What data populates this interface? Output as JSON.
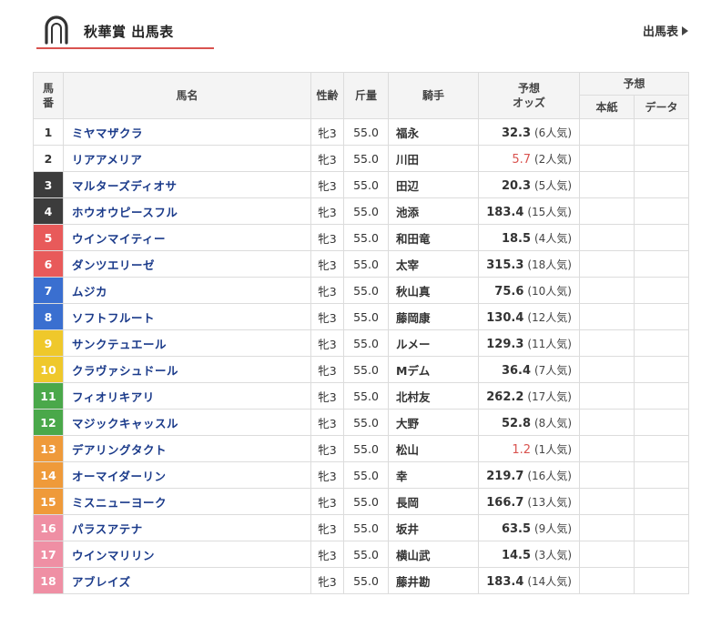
{
  "header": {
    "title": "秋華賞 出馬表",
    "link_label": "出馬表"
  },
  "colors": {
    "accent": "#d9534f",
    "horse_name": "#1a3a8a"
  },
  "table": {
    "col_num": "馬番",
    "col_name": "馬名",
    "col_sex_age": "性齢",
    "col_weight": "斤量",
    "col_jockey": "騎手",
    "col_odds_l1": "予想",
    "col_odds_l2": "オッズ",
    "col_prediction": "予想",
    "col_pred_paper": "本紙",
    "col_pred_data": "データ"
  },
  "rows": [
    {
      "num": "1",
      "name": "ミヤマザクラ",
      "sex_age": "牝3",
      "weight": "55.0",
      "jockey": "福永",
      "odds": "32.3",
      "pop": "(6人気)",
      "bg": "#ffffff",
      "fg": "#333333"
    },
    {
      "num": "2",
      "name": "リアアメリア",
      "sex_age": "牝3",
      "weight": "55.0",
      "jockey": "川田",
      "odds": "5.7",
      "pop": "(2人気)",
      "bg": "#ffffff",
      "fg": "#333333"
    },
    {
      "num": "3",
      "name": "マルターズディオサ",
      "sex_age": "牝3",
      "weight": "55.0",
      "jockey": "田辺",
      "odds": "20.3",
      "pop": "(5人気)",
      "bg": "#3c3c3c",
      "fg": "#ffffff"
    },
    {
      "num": "4",
      "name": "ホウオウピースフル",
      "sex_age": "牝3",
      "weight": "55.0",
      "jockey": "池添",
      "odds": "183.4",
      "pop": "(15人気)",
      "bg": "#3c3c3c",
      "fg": "#ffffff"
    },
    {
      "num": "5",
      "name": "ウインマイティー",
      "sex_age": "牝3",
      "weight": "55.0",
      "jockey": "和田竜",
      "odds": "18.5",
      "pop": "(4人気)",
      "bg": "#e85a5a",
      "fg": "#ffffff"
    },
    {
      "num": "6",
      "name": "ダンツエリーゼ",
      "sex_age": "牝3",
      "weight": "55.0",
      "jockey": "太宰",
      "odds": "315.3",
      "pop": "(18人気)",
      "bg": "#e85a5a",
      "fg": "#ffffff"
    },
    {
      "num": "7",
      "name": "ムジカ",
      "sex_age": "牝3",
      "weight": "55.0",
      "jockey": "秋山真",
      "odds": "75.6",
      "pop": "(10人気)",
      "bg": "#3a6fd0",
      "fg": "#ffffff"
    },
    {
      "num": "8",
      "name": "ソフトフルート",
      "sex_age": "牝3",
      "weight": "55.0",
      "jockey": "藤岡康",
      "odds": "130.4",
      "pop": "(12人気)",
      "bg": "#3a6fd0",
      "fg": "#ffffff"
    },
    {
      "num": "9",
      "name": "サンクテュエール",
      "sex_age": "牝3",
      "weight": "55.0",
      "jockey": "ルメー",
      "odds": "129.3",
      "pop": "(11人気)",
      "bg": "#efc82b",
      "fg": "#ffffff"
    },
    {
      "num": "10",
      "name": "クラヴァシュドール",
      "sex_age": "牝3",
      "weight": "55.0",
      "jockey": "Mデム",
      "odds": "36.4",
      "pop": "(7人気)",
      "bg": "#efc82b",
      "fg": "#ffffff"
    },
    {
      "num": "11",
      "name": "フィオリキアリ",
      "sex_age": "牝3",
      "weight": "55.0",
      "jockey": "北村友",
      "odds": "262.2",
      "pop": "(17人気)",
      "bg": "#4aa84a",
      "fg": "#ffffff"
    },
    {
      "num": "12",
      "name": "マジックキャッスル",
      "sex_age": "牝3",
      "weight": "55.0",
      "jockey": "大野",
      "odds": "52.8",
      "pop": "(8人気)",
      "bg": "#4aa84a",
      "fg": "#ffffff"
    },
    {
      "num": "13",
      "name": "デアリングタクト",
      "sex_age": "牝3",
      "weight": "55.0",
      "jockey": "松山",
      "odds": "1.2",
      "pop": "(1人気)",
      "bg": "#ef9a3a",
      "fg": "#ffffff"
    },
    {
      "num": "14",
      "name": "オーマイダーリン",
      "sex_age": "牝3",
      "weight": "55.0",
      "jockey": "幸",
      "odds": "219.7",
      "pop": "(16人気)",
      "bg": "#ef9a3a",
      "fg": "#ffffff"
    },
    {
      "num": "15",
      "name": "ミスニューヨーク",
      "sex_age": "牝3",
      "weight": "55.0",
      "jockey": "長岡",
      "odds": "166.7",
      "pop": "(13人気)",
      "bg": "#ef9a3a",
      "fg": "#ffffff"
    },
    {
      "num": "16",
      "name": "パラスアテナ",
      "sex_age": "牝3",
      "weight": "55.0",
      "jockey": "坂井",
      "odds": "63.5",
      "pop": "(9人気)",
      "bg": "#ef8fa4",
      "fg": "#ffffff"
    },
    {
      "num": "17",
      "name": "ウインマリリン",
      "sex_age": "牝3",
      "weight": "55.0",
      "jockey": "横山武",
      "odds": "14.5",
      "pop": "(3人気)",
      "bg": "#ef8fa4",
      "fg": "#ffffff"
    },
    {
      "num": "18",
      "name": "アブレイズ",
      "sex_age": "牝3",
      "weight": "55.0",
      "jockey": "藤井勘",
      "odds": "183.4",
      "pop": "(14人気)",
      "bg": "#ef8fa4",
      "fg": "#ffffff"
    }
  ]
}
